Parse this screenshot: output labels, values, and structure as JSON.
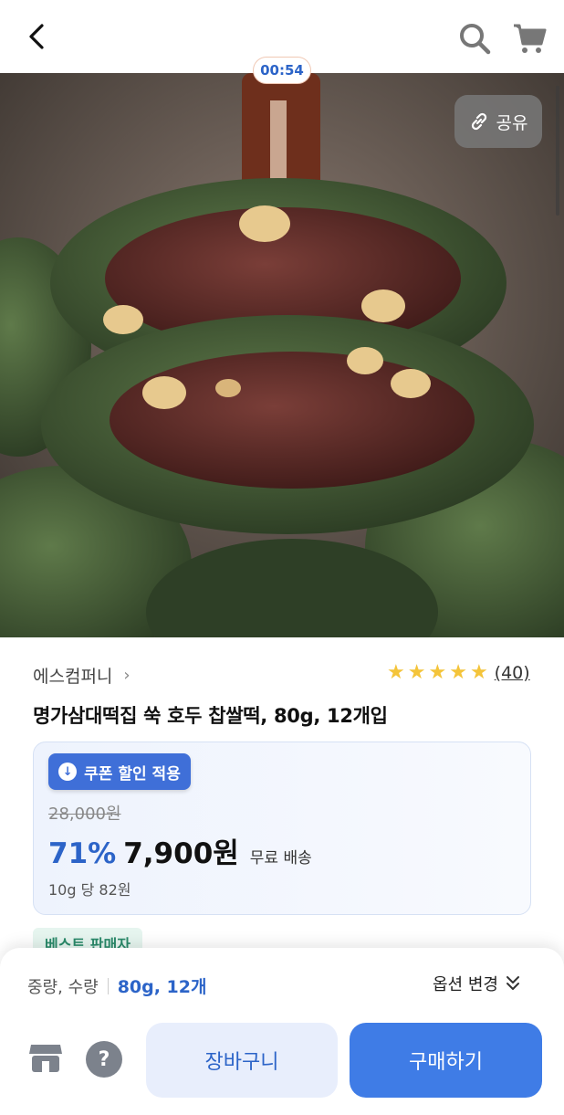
{
  "header": {
    "back_icon": "chevron-left-icon",
    "search_icon": "search-icon",
    "cart_icon": "cart-icon"
  },
  "hero": {
    "timer": "00:54",
    "share_label": "공유",
    "share_icon": "link-icon"
  },
  "product": {
    "brand": "에스컴퍼니",
    "rating_stars": 5,
    "review_count": "(40)",
    "title": "명가삼대떡집 쑥 호두 찹쌀떡, 80g, 12개입"
  },
  "price": {
    "coupon_label": "쿠폰 할인 적용",
    "original_price": "28,000원",
    "discount_rate": "71%",
    "sale_price": "7,900원",
    "shipping": "무료 배송",
    "unit_price": "10g 당 82원"
  },
  "badges": {
    "best_seller": "베스트 판매자"
  },
  "bottom": {
    "option_label": "중량, 수량",
    "option_value": "80g, 12개",
    "option_change": "옵션 변경",
    "add_to_cart": "장바구니",
    "buy_now": "구매하기"
  },
  "colors": {
    "accent_blue": "#3f7ce6",
    "price_blue": "#2c64c8",
    "star": "#f4c43a"
  }
}
